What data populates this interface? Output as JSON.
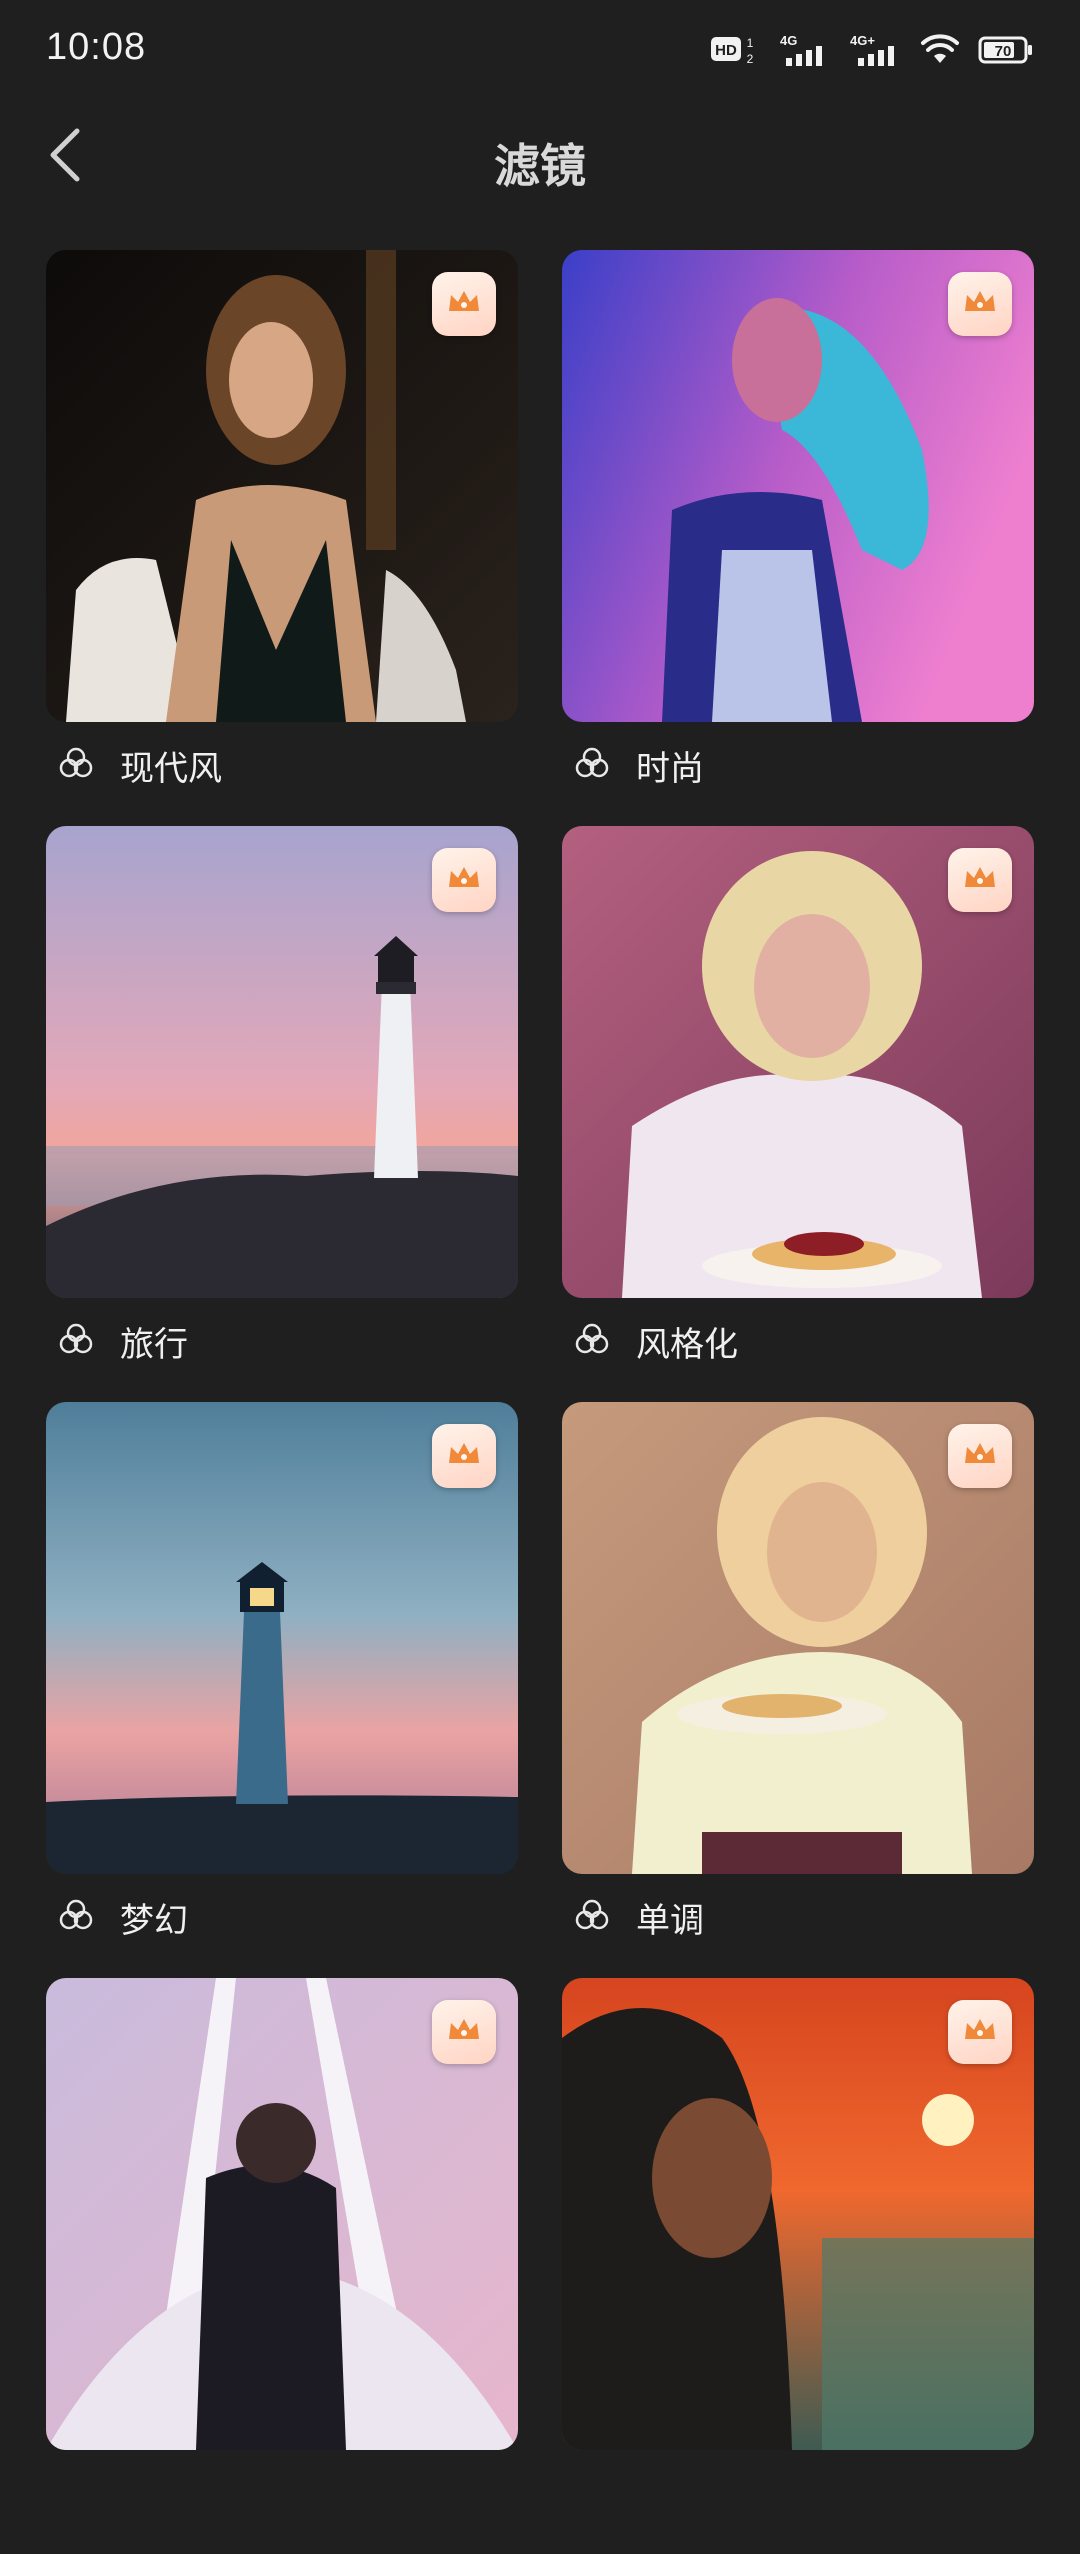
{
  "status_bar": {
    "time": "10:08",
    "icons": [
      "hd-icon",
      "signal-4g-icon",
      "signal-4g-plus-icon",
      "wifi-icon",
      "battery-icon"
    ],
    "battery_level": "70"
  },
  "header": {
    "back_icon": "chevron-left-icon",
    "title": "滤镜"
  },
  "filters": [
    {
      "name": "现代风",
      "premium": true
    },
    {
      "name": "时尚",
      "premium": true
    },
    {
      "name": "旅行",
      "premium": true
    },
    {
      "name": "风格化",
      "premium": true
    },
    {
      "name": "梦幻",
      "premium": true
    },
    {
      "name": "单调",
      "premium": true
    },
    {
      "premium": true
    },
    {
      "premium": true
    }
  ],
  "colors": {
    "background": "#1f1f1f",
    "crown_badge": "#ffd4c4",
    "crown": "#f08a3a"
  }
}
